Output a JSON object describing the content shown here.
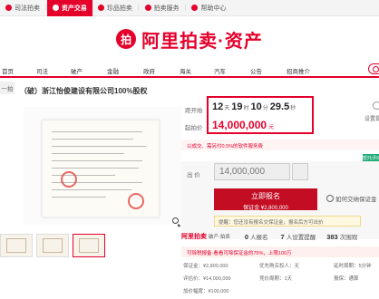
{
  "topbar": {
    "tabs": [
      {
        "label": "司法拍卖",
        "active": false
      },
      {
        "label": "资产交易",
        "active": true
      },
      {
        "label": "珍品拍卖",
        "active": false
      },
      {
        "label": "拍卖服务",
        "active": false
      },
      {
        "label": "帮助中心",
        "active": false
      }
    ]
  },
  "logo": {
    "mark": "拍",
    "text": "阿里拍卖·资产"
  },
  "nav": {
    "items": [
      "首页",
      "司法",
      "破产",
      "金融",
      "政府",
      "海关",
      "汽车",
      "公告",
      "招商推介"
    ]
  },
  "breadcrumb": "一拍",
  "title": "（破）浙江怡俊建设有限公司100%股权",
  "auction": {
    "countdown_label": "距开始",
    "countdown": {
      "days": "12",
      "days_unit": "天",
      "hours": "19",
      "hours_unit": "时",
      "minutes": "10",
      "minutes_unit": "分",
      "seconds": "29.5",
      "seconds_unit": "秒"
    },
    "start_price_label": "起拍价",
    "start_price": "14,000,000",
    "currency": "元",
    "remind_label": "设置提醒",
    "tip": "以成交、需另付0.5%的软件服务费"
  },
  "bid": {
    "label": "出  价",
    "value": "14,000,000",
    "signup_label": "立即报名",
    "deposit_label": "保证金 ¥2,800,000",
    "howto_label": "如何交纳保证金",
    "reminder": "提醒：您还没有报名交保证金，报名后方可出价",
    "side_badge": "帮托评价"
  },
  "stats": {
    "logo": "阿里拍卖",
    "subtitle": "破产·拍卖",
    "signups": "0",
    "signups_unit": "人报名",
    "reminders": "7",
    "reminders_unit": "人设置提醒",
    "views": "383",
    "views_unit": "次围观"
  },
  "warning": "可除税报备·看看可除保证金的75%，上限100万",
  "info": {
    "deposit": "保证金：¥2,800,000",
    "assess": "评估价：¥14,000,000",
    "increment": "加价幅度：¥100,000",
    "priority": "优先购买权人：无",
    "period": "竞价周期：1天",
    "delay": "延时周期：5分钟",
    "guarantee": "报保：通算"
  }
}
